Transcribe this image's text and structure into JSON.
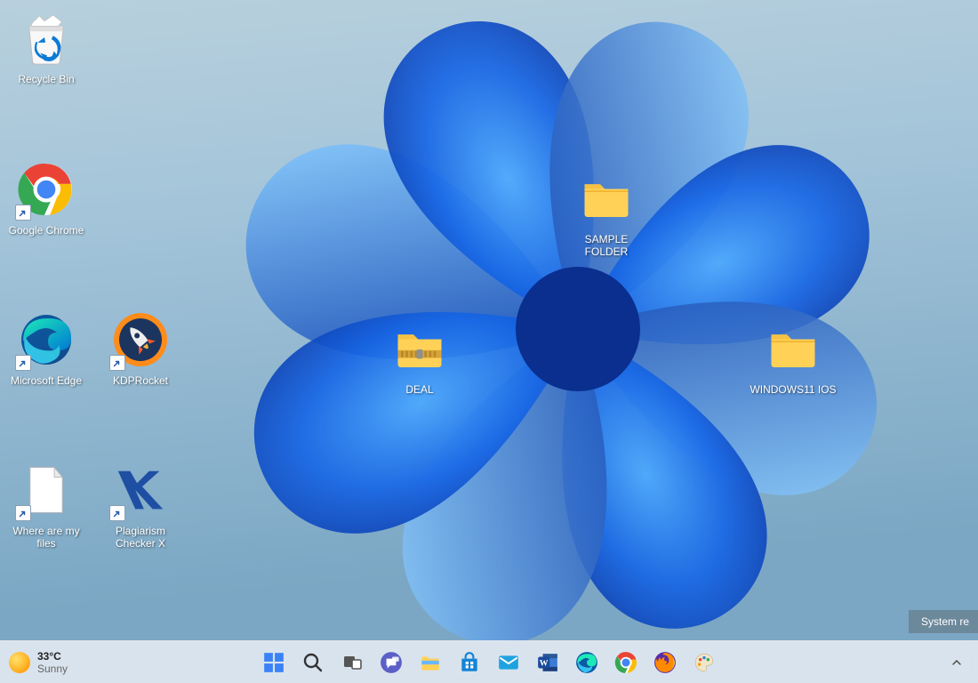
{
  "wallpaper": {
    "name": "Windows 11 Bloom"
  },
  "desktop_icons": {
    "recycle_bin": {
      "label": "Recycle Bin"
    },
    "chrome": {
      "label": "Google Chrome",
      "shortcut": true
    },
    "edge": {
      "label": "Microsoft Edge",
      "shortcut": true
    },
    "kdprocket": {
      "label": "KDPRocket",
      "shortcut": true
    },
    "where_files": {
      "label": "Where are my files",
      "shortcut": true
    },
    "plagiarism": {
      "label": "Plagiarism Checker X",
      "shortcut": true
    },
    "sample_folder": {
      "label": "SAMPLE FOLDER"
    },
    "deal": {
      "label": "DEAL"
    },
    "windows11_ios": {
      "label": "WINDOWS11 IOS"
    }
  },
  "notification": {
    "text": "System re"
  },
  "taskbar": {
    "weather": {
      "temp": "33°C",
      "condition": "Sunny"
    },
    "apps": {
      "start": "Start",
      "search": "Search",
      "taskview": "Task view",
      "chat": "Chat",
      "explorer": "File Explorer",
      "store": "Microsoft Store",
      "mail": "Mail",
      "word": "Word",
      "edge": "Microsoft Edge",
      "chrome": "Google Chrome",
      "firefox": "Firefox",
      "paint": "Paint"
    },
    "tray": {
      "chevron": "Show hidden icons"
    }
  }
}
